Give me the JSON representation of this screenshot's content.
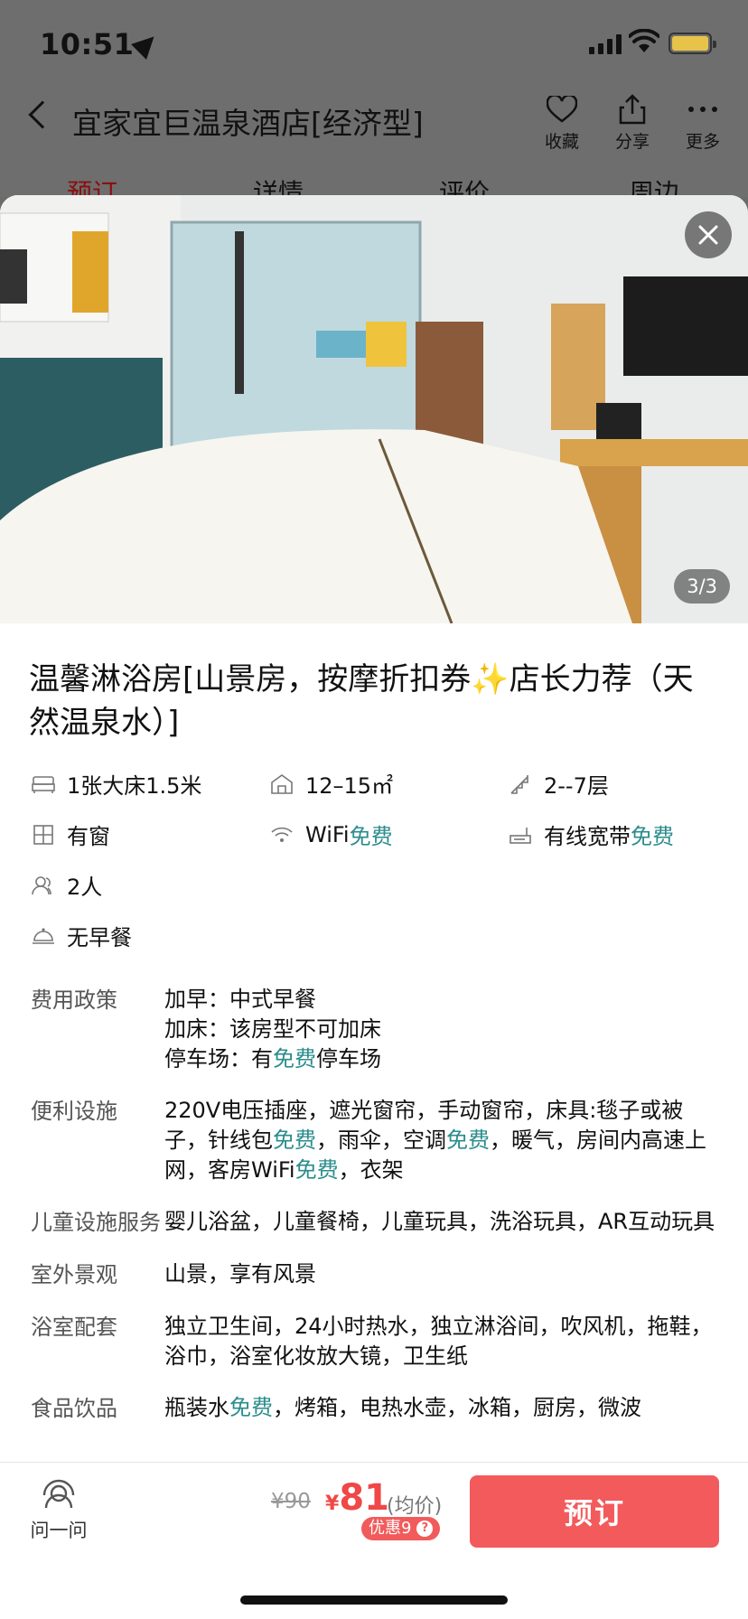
{
  "status_bar": {
    "time": "10:51"
  },
  "nav": {
    "title": "宜家宜巨温泉酒店[经济型]",
    "actions": [
      {
        "label": "收藏",
        "icon": "heart-icon"
      },
      {
        "label": "分享",
        "icon": "share-icon"
      },
      {
        "label": "更多",
        "icon": "more-icon"
      }
    ],
    "tabs": [
      "预订",
      "详情",
      "评价",
      "周边"
    ]
  },
  "photo": {
    "counter": "3/3"
  },
  "room": {
    "title": "温馨淋浴房[山景房，按摩折扣券✨店长力荐（天然温泉水）]",
    "attrs": {
      "bed": "1张大床1.5米",
      "area": "12–15㎡",
      "floor": "2--7层",
      "window": "有窗",
      "wifi": "WiFi",
      "wifi_free": "免费",
      "broadband": "有线宽带",
      "broadband_free": "免费",
      "guests": "2人",
      "breakfast": "无早餐"
    }
  },
  "policies": {
    "fee_label": "费用政策",
    "fee_line1": "加早：中式早餐",
    "fee_line2": "加床：该房型不可加床",
    "fee_line3_a": "停车场：有",
    "fee_line3_free": "免费",
    "fee_line3_b": "停车场",
    "facility_label": "便利设施",
    "facility_a": "220V电压插座，遮光窗帘，手动窗帘，床具:毯子或被子，针线包",
    "facility_free1": "免费",
    "facility_b": "，雨伞，空调",
    "facility_free2": "免费",
    "facility_c": "，暖气，房间内高速上网，客房WiFi",
    "facility_free3": "免费",
    "facility_d": "，衣架",
    "kids_label": "儿童设施服务",
    "kids_value": "婴儿浴盆，儿童餐椅，儿童玩具，洗浴玩具，AR互动玩具",
    "view_label": "室外景观",
    "view_value": "山景，享有风景",
    "bath_label": "浴室配套",
    "bath_value": "独立卫生间，24小时热水，独立淋浴间，吹风机，拖鞋，浴巾，浴室化妆放大镜，卫生纸",
    "food_label": "食品饮品",
    "food_a": "瓶装水",
    "food_free": "免费",
    "food_b": "，烤箱，电热水壶，冰箱，厨房，微波"
  },
  "bottom": {
    "ask_label": "问一问",
    "price_old": "¥90",
    "price_symbol": "¥",
    "price_current": "81",
    "price_unit": "(均价)",
    "discount": "优惠9",
    "book_label": "预订"
  },
  "colors": {
    "accent_free": "#2b8c8c",
    "price": "#f04747",
    "book_button": "#f25a5c"
  }
}
